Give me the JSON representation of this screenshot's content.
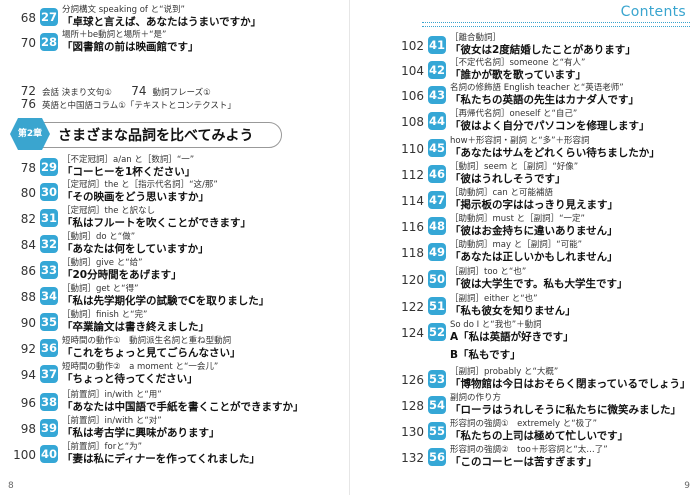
{
  "header": {
    "contents_label": "Contents"
  },
  "left": {
    "page_number": "8",
    "top_entries": [
      {
        "page": "68",
        "no": "27",
        "grammar": "分詞構文 speaking of と“说到”",
        "example": "「卓球と言えば、あなたはうまいですか」"
      },
      {
        "page": "70",
        "no": "28",
        "grammar": "場所＋be動詞と場所＋“是”",
        "example": "「図書館の前は映画館です」"
      }
    ],
    "small_row1": {
      "page_a": "72",
      "text_a": "会話 決まり文句①",
      "page_b": "74",
      "text_b": "動詞フレーズ①"
    },
    "small_row2": {
      "page": "76",
      "text": "英語と中国語コラム①「テキストとコンテクスト」"
    },
    "chapter": {
      "tag": "第2章",
      "title": "さまざまな品詞を比べてみよう"
    },
    "entries": [
      {
        "page": "78",
        "no": "29",
        "grammar": "［不定冠詞］a/an と［数詞］“一”",
        "example": "「コーヒーを1杯ください」"
      },
      {
        "page": "80",
        "no": "30",
        "grammar": "［定冠詞］the と［指示代名詞］“这/那”",
        "example": "「その映画をどう思いますか」"
      },
      {
        "page": "82",
        "no": "31",
        "grammar": "［定冠詞］the と訳なし",
        "example": "「私はフルートを吹くことができます」"
      },
      {
        "page": "84",
        "no": "32",
        "grammar": "［動詞］do と“做”",
        "example": "「あなたは何をしていますか」"
      },
      {
        "page": "86",
        "no": "33",
        "grammar": "［動詞］give と“给”",
        "example": "「20分時間をあげます」"
      },
      {
        "page": "88",
        "no": "34",
        "grammar": "［動詞］get と“得”",
        "example": "「私は先学期化学の試験でCを取りました」"
      },
      {
        "page": "90",
        "no": "35",
        "grammar": "［動詞］finish と“完”",
        "example": "「卒業論文は書き終えました」"
      },
      {
        "page": "92",
        "no": "36",
        "grammar": "短時間の動作①　動詞派生名詞と重ね型動詞",
        "example": "「これをちょっと見てごらんなさい」"
      },
      {
        "page": "94",
        "no": "37",
        "grammar": "短時間の動作②　a moment と“一会儿”",
        "example": "「ちょっと待ってください」"
      },
      {
        "page": "96",
        "no": "38",
        "grammar": "［前置詞］in/with と“用”",
        "example": "「あなたは中国語で手紙を書くことができますか」"
      },
      {
        "page": "98",
        "no": "39",
        "grammar": "［前置詞］in/with と“对”",
        "example": "「私は考古学に興味があります」"
      },
      {
        "page": "100",
        "no": "40",
        "grammar": "［前置詞］forと“为”",
        "example": "「妻は私にディナーを作ってくれました」"
      }
    ]
  },
  "right": {
    "page_number": "9",
    "entries": [
      {
        "page": "102",
        "no": "41",
        "grammar": "［離合動詞］",
        "example": "「彼女は2度結婚したことがあります」"
      },
      {
        "page": "104",
        "no": "42",
        "grammar": "［不定代名詞］someone と“有人”",
        "example": "「誰かが歌を歌っています」"
      },
      {
        "page": "106",
        "no": "43",
        "grammar": "名詞の修飾語 English teacher と“英语老师”",
        "example": "「私たちの英語の先生はカナダ人です」"
      },
      {
        "page": "108",
        "no": "44",
        "grammar": "［再帰代名詞］oneself と“自己”",
        "example": "「彼はよく自分でパソコンを修理します」"
      },
      {
        "page": "110",
        "no": "45",
        "grammar": "how＋形容詞・副詞 と“多”＋形容詞",
        "example": "「あなたはサムをどれくらい待ちましたか」"
      },
      {
        "page": "112",
        "no": "46",
        "grammar": "［動詞］seem と［副詞］“好像”",
        "example": "「彼はうれしそうです」"
      },
      {
        "page": "114",
        "no": "47",
        "grammar": "［助動詞］can と可能補語",
        "example": "「掲示板の字ははっきり見えます」"
      },
      {
        "page": "116",
        "no": "48",
        "grammar": "［助動詞］must と［副詞］“一定”",
        "example": "「彼はお金持ちに違いありません」"
      },
      {
        "page": "118",
        "no": "49",
        "grammar": "［助動詞］may と［副詞］“可能”",
        "example": "「あなたは正しいかもしれません」"
      },
      {
        "page": "120",
        "no": "50",
        "grammar": "［副詞］too と“也”",
        "example": "「彼は大学生です。私も大学生です」"
      },
      {
        "page": "122",
        "no": "51",
        "grammar": "［副詞］either と“也”",
        "example": "「私も彼女を知りません」"
      },
      {
        "page": "124",
        "no": "52",
        "grammar": "So do I と“我也”＋動詞",
        "example": "A「私は英語が好きです」",
        "example2": "B「私もです」"
      },
      {
        "page": "126",
        "no": "53",
        "grammar": "［副詞］probably と“大概”",
        "example": "「博物館は今日はおそらく閉まっているでしょう」"
      },
      {
        "page": "128",
        "no": "54",
        "grammar": "副詞の作り方",
        "example": "「ローラはうれしそうに私たちに微笑みました」"
      },
      {
        "page": "130",
        "no": "55",
        "grammar": "形容詞の強調①　extremely と“极了”",
        "example": "「私たちの上司は極めて忙しいです」"
      },
      {
        "page": "132",
        "no": "56",
        "grammar": "形容詞の強調②　too＋形容詞と“太…了”",
        "example": "「このコーヒーは苦すぎます」"
      }
    ]
  },
  "colors": {
    "accent": "#35a7d6",
    "text": "#222222"
  }
}
